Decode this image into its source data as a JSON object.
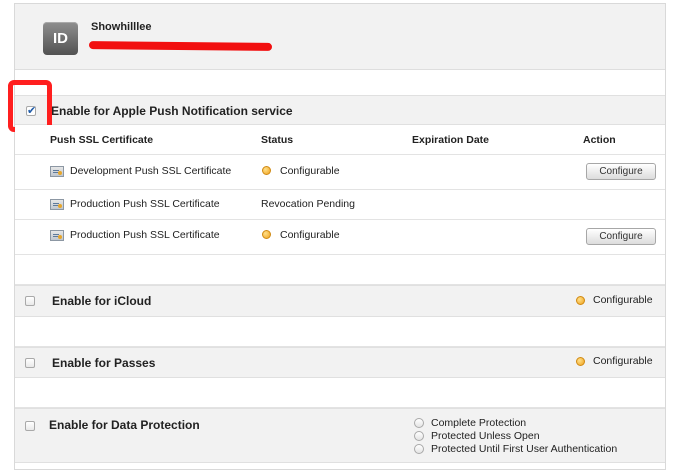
{
  "app": {
    "badge": "ID",
    "name": "Showhilllee"
  },
  "push": {
    "title": "Enable for Apple Push Notification service",
    "checked": true,
    "columns": [
      "Push SSL Certificate",
      "Status",
      "Expiration Date",
      "Action"
    ],
    "rows": [
      {
        "certificate": "Development Push SSL Certificate",
        "status": "Configurable",
        "status_dot": true,
        "expiration": "",
        "action": "Configure"
      },
      {
        "certificate": "Production Push SSL Certificate",
        "status": "Revocation Pending",
        "status_dot": false,
        "expiration": "",
        "action": ""
      },
      {
        "certificate": "Production Push SSL Certificate",
        "status": "Configurable",
        "status_dot": true,
        "expiration": "",
        "action": "Configure"
      }
    ]
  },
  "icloud": {
    "title": "Enable for iCloud",
    "checked": false,
    "status": "Configurable"
  },
  "passes": {
    "title": "Enable for Passes",
    "checked": false,
    "status": "Configurable"
  },
  "data_protection": {
    "title": "Enable for Data Protection",
    "checked": false,
    "options": [
      "Complete Protection",
      "Protected Unless Open",
      "Protected Until First User Authentication"
    ]
  },
  "colors": {
    "highlight": "#ff1f1f",
    "redaction": "#f20f0f",
    "status_dot": "#f0a21c",
    "checkmark": "#1e5aa8"
  }
}
